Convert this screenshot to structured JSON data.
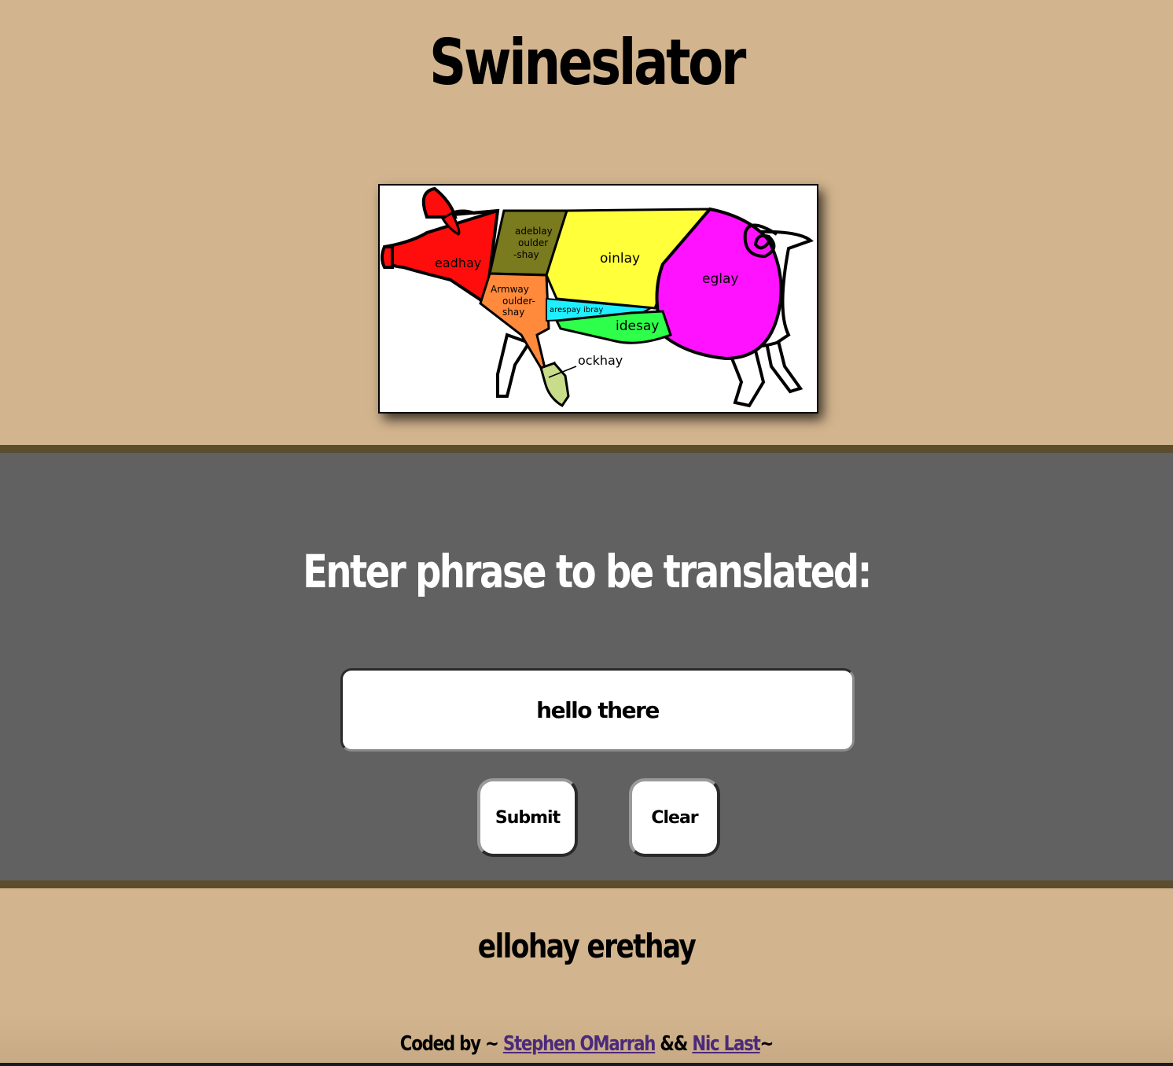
{
  "header": {
    "title": "Swineslator"
  },
  "pig_diagram": {
    "labels": {
      "head": "eadhay",
      "blade_shoulder_1": "adeblay",
      "blade_shoulder_2": "oulder",
      "blade_shoulder_3": "-shay",
      "loin": "oinlay",
      "leg": "eglay",
      "arm_shoulder_1": "Armway",
      "arm_shoulder_2": "oulder-",
      "arm_shoulder_3": "shay",
      "spare_ribs": "arespay ibray",
      "side": "idesay",
      "hock": "ockhay"
    },
    "colors": {
      "head": "#ff0d0d",
      "blade_shoulder": "#7a7a1e",
      "loin": "#ffff3a",
      "leg": "#ff12ff",
      "arm_shoulder": "#ff8a3c",
      "spare_ribs": "#1ef0ff",
      "side": "#2dff4a",
      "hock": "#c8dc8a"
    }
  },
  "translator": {
    "prompt": "Enter phrase to be translated:",
    "input_value": "hello there",
    "submit_label": "Submit",
    "clear_label": "Clear"
  },
  "output": {
    "translated_text": "ellohay erethay"
  },
  "footer": {
    "prefix": "Coded by ~ ",
    "author1": "Stephen OMarrah",
    "separator": " && ",
    "author2": "Nic Last",
    "suffix": "~"
  },
  "colors": {
    "background": "#d2b48e",
    "panel": "#616161",
    "divider": "#5b4d2d",
    "link": "#4b2a7a"
  }
}
